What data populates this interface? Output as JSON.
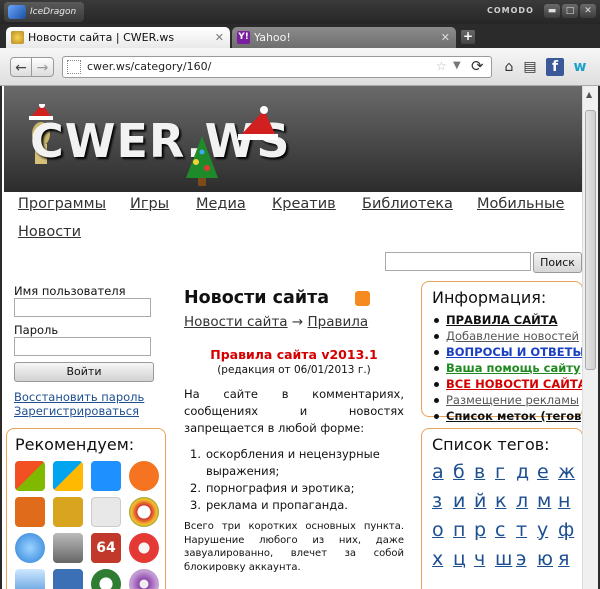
{
  "browser": {
    "brand": "IceDragon",
    "vendor": "COMODO",
    "window_buttons": [
      "▬",
      "□",
      "✕"
    ],
    "tabs": [
      {
        "title": "Новости сайта | CWER.ws",
        "active": true
      },
      {
        "title": "Yahoo!",
        "active": false
      }
    ],
    "new_tab": "+",
    "url": "cwer.ws/category/160/"
  },
  "site": {
    "logo": "CWER.WS",
    "nav": [
      "Программы",
      "Игры",
      "Медиа",
      "Креатив",
      "Библиотека",
      "Мобильные",
      "Новости"
    ],
    "search_button": "Поиск"
  },
  "login": {
    "username_label": "Имя пользователя",
    "password_label": "Пароль",
    "submit": "Войти",
    "restore": "Восстановить пароль",
    "register": "Зарегистрироваться"
  },
  "recommend": {
    "title": "Рекомендуем:"
  },
  "content": {
    "title": "Новости сайта",
    "breadcrumb_home": "Новости сайта",
    "breadcrumb_sep": "→",
    "breadcrumb_current": "Правила",
    "rules_title": "Правила сайта v2013.1",
    "rules_sub": "(редакция от 06/01/2013 г.)",
    "intro": "На сайте в комментариях, сообщениях и новостях запрещается в любой форме:",
    "items": [
      "оскорбления и нецензурные выражения;",
      "порнография и эротика;",
      "реклама и пропаганда."
    ],
    "footnote": "Всего три коротких основных пункта. Нарушение любого из них, даже завуалированно, влечет за собой блокировку аккаунта."
  },
  "info": {
    "title": "Информация:",
    "items": [
      {
        "label": "ПРАВИЛА САЙТА",
        "color": "#111111",
        "bold": true
      },
      {
        "label": "Добавление новостей",
        "color": "#555555",
        "bold": false
      },
      {
        "label": "ВОПРОСЫ И ОТВЕТЫ",
        "color": "#1a3fc4",
        "bold": true
      },
      {
        "label": "Ваша помощь сайту",
        "color": "#1f8a1f",
        "bold": true
      },
      {
        "label": "ВСЕ НОВОСТИ САЙТА",
        "color": "#d40000",
        "bold": true
      },
      {
        "label": "Размещение рекламы",
        "color": "#555555",
        "bold": false
      },
      {
        "label": "Список меток (тегов)",
        "color": "#111111",
        "bold": true
      }
    ]
  },
  "tags": {
    "title": "Список тегов:",
    "letters": [
      "а",
      "б",
      "в",
      "г",
      "д",
      "е",
      "ж",
      "з",
      "и",
      "й",
      "к",
      "л",
      "м",
      "н",
      "о",
      "п",
      "р",
      "с",
      "т",
      "у",
      "ф",
      "х",
      "ц",
      "ч",
      "ш",
      "э",
      "ю",
      "я"
    ]
  }
}
